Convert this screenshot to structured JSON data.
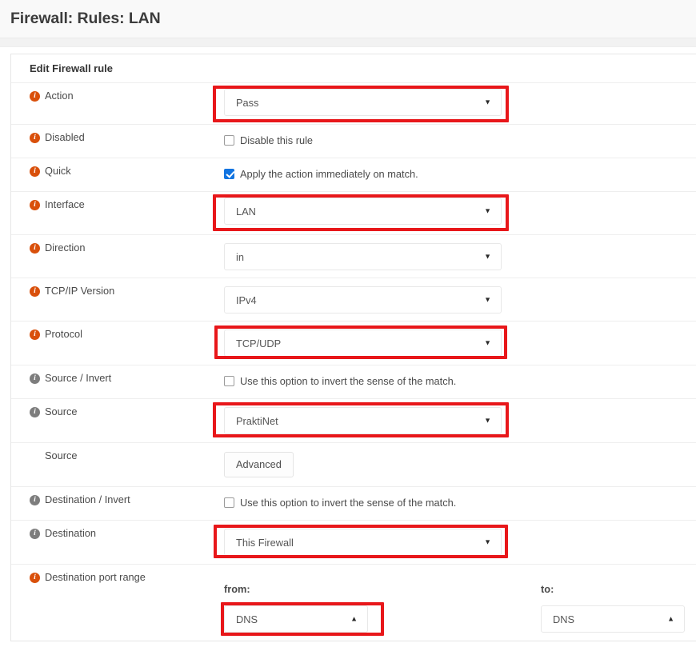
{
  "page": {
    "title": "Firewall: Rules: LAN"
  },
  "panel": {
    "heading": "Edit Firewall rule"
  },
  "colors": {
    "highlight": "#e8171a",
    "required_icon": "#d9500b",
    "optional_icon": "#7d7d7d",
    "checkbox_checked": "#1274e0"
  },
  "icons": {
    "info": "i",
    "caret_down": "▼",
    "caret_up": "▲"
  },
  "form": {
    "action": {
      "label": "Action",
      "value": "Pass",
      "required": true,
      "highlighted": true
    },
    "disabled": {
      "label": "Disabled",
      "checkbox_label": "Disable this rule",
      "checked": false,
      "required": true
    },
    "quick": {
      "label": "Quick",
      "checkbox_label": "Apply the action immediately on match.",
      "checked": true,
      "required": true
    },
    "interface": {
      "label": "Interface",
      "value": "LAN",
      "required": true,
      "highlighted": true
    },
    "direction": {
      "label": "Direction",
      "value": "in",
      "required": true,
      "highlighted": false
    },
    "tcpip_version": {
      "label": "TCP/IP Version",
      "value": "IPv4",
      "required": true,
      "highlighted": false
    },
    "protocol": {
      "label": "Protocol",
      "value": "TCP/UDP",
      "required": true,
      "highlighted": true
    },
    "source_invert": {
      "label": "Source / Invert",
      "checkbox_label": "Use this option to invert the sense of the match.",
      "checked": false,
      "required": false
    },
    "source": {
      "label": "Source",
      "value": "PraktiNet",
      "required": false,
      "highlighted": true
    },
    "source_advanced": {
      "label": "Source",
      "button_label": "Advanced",
      "required": false
    },
    "destination_invert": {
      "label": "Destination / Invert",
      "checkbox_label": "Use this option to invert the sense of the match.",
      "checked": false,
      "required": false
    },
    "destination": {
      "label": "Destination",
      "value": "This Firewall",
      "required": false,
      "highlighted": true
    },
    "destination_port_range": {
      "label": "Destination port range",
      "required": true,
      "from_label": "from:",
      "from_value": "DNS",
      "from_highlighted": true,
      "to_label": "to:",
      "to_value": "DNS",
      "to_highlighted": false
    }
  }
}
